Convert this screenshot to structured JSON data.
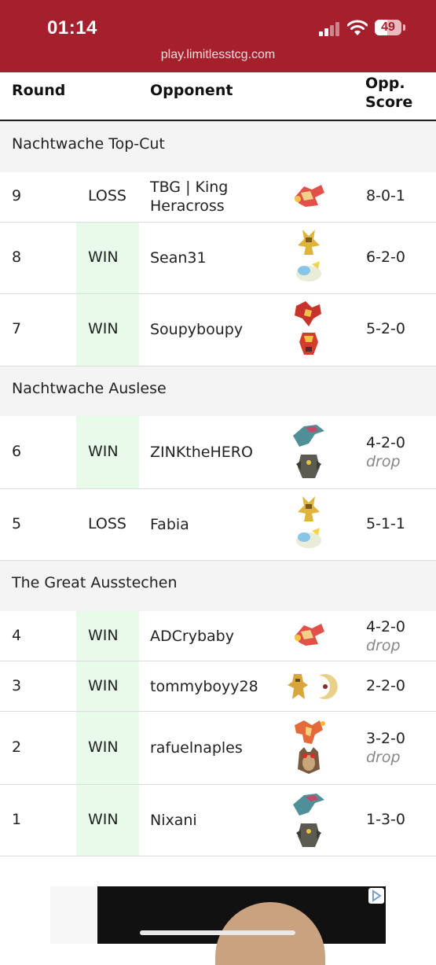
{
  "status_bar": {
    "time": "01:14",
    "battery": "49",
    "url": "play.limitlesstcg.com"
  },
  "table": {
    "headers": {
      "round": "Round",
      "opponent": "Opponent",
      "score_line1": "Opp.",
      "score_line2": "Score"
    },
    "sections": [
      {
        "title": "Nachtwache Top-Cut"
      },
      {
        "title": "Nachtwache Auslese"
      },
      {
        "title": "The Great Ausstechen"
      }
    ],
    "rows": [
      {
        "round": "9",
        "result": "LOSS",
        "name": "TBG | King Heracross",
        "score": "8-0-1",
        "drop": "",
        "sprites": [
          "pidgeot-icon"
        ]
      },
      {
        "round": "8",
        "result": "WIN",
        "name": "Sean31",
        "score": "6-2-0",
        "drop": "",
        "sprites": [
          "alakazam-icon",
          "dudunsparce-icon"
        ]
      },
      {
        "round": "7",
        "result": "WIN",
        "name": "Soupyboupy",
        "score": "5-2-0",
        "drop": "",
        "sprites": [
          "ho-oh-icon",
          "armarouge-icon"
        ]
      },
      {
        "round": "6",
        "result": "WIN",
        "name": "ZINKtheHERO",
        "score": "4-2-0",
        "drop": "drop",
        "sprites": [
          "dragapult-icon",
          "dusknoir-icon"
        ]
      },
      {
        "round": "5",
        "result": "LOSS",
        "name": "Fabia",
        "score": "5-1-1",
        "drop": "",
        "sprites": [
          "alakazam-icon",
          "dudunsparce-icon"
        ]
      },
      {
        "round": "4",
        "result": "WIN",
        "name": "ADCrybaby",
        "score": "4-2-0",
        "drop": "drop",
        "sprites": [
          "pidgeot-icon"
        ]
      },
      {
        "round": "3",
        "result": "WIN",
        "name": "tommyboyy28",
        "score": "2-2-0",
        "drop": "",
        "sprites": [
          "regidrago-icon",
          "lunatone-icon"
        ]
      },
      {
        "round": "2",
        "result": "WIN",
        "name": "rafuelnaples",
        "score": "3-2-0",
        "drop": "drop",
        "sprites": [
          "charizard-icon",
          "noctowl-icon"
        ]
      },
      {
        "round": "1",
        "result": "WIN",
        "name": "Nixani",
        "score": "1-3-0",
        "drop": "",
        "sprites": [
          "dragapult-icon",
          "dusknoir-icon"
        ]
      }
    ]
  },
  "colors": {
    "topbar": "#a51f2c",
    "win_bg": "#e8fbea",
    "section_bg": "#f4f4f4"
  }
}
